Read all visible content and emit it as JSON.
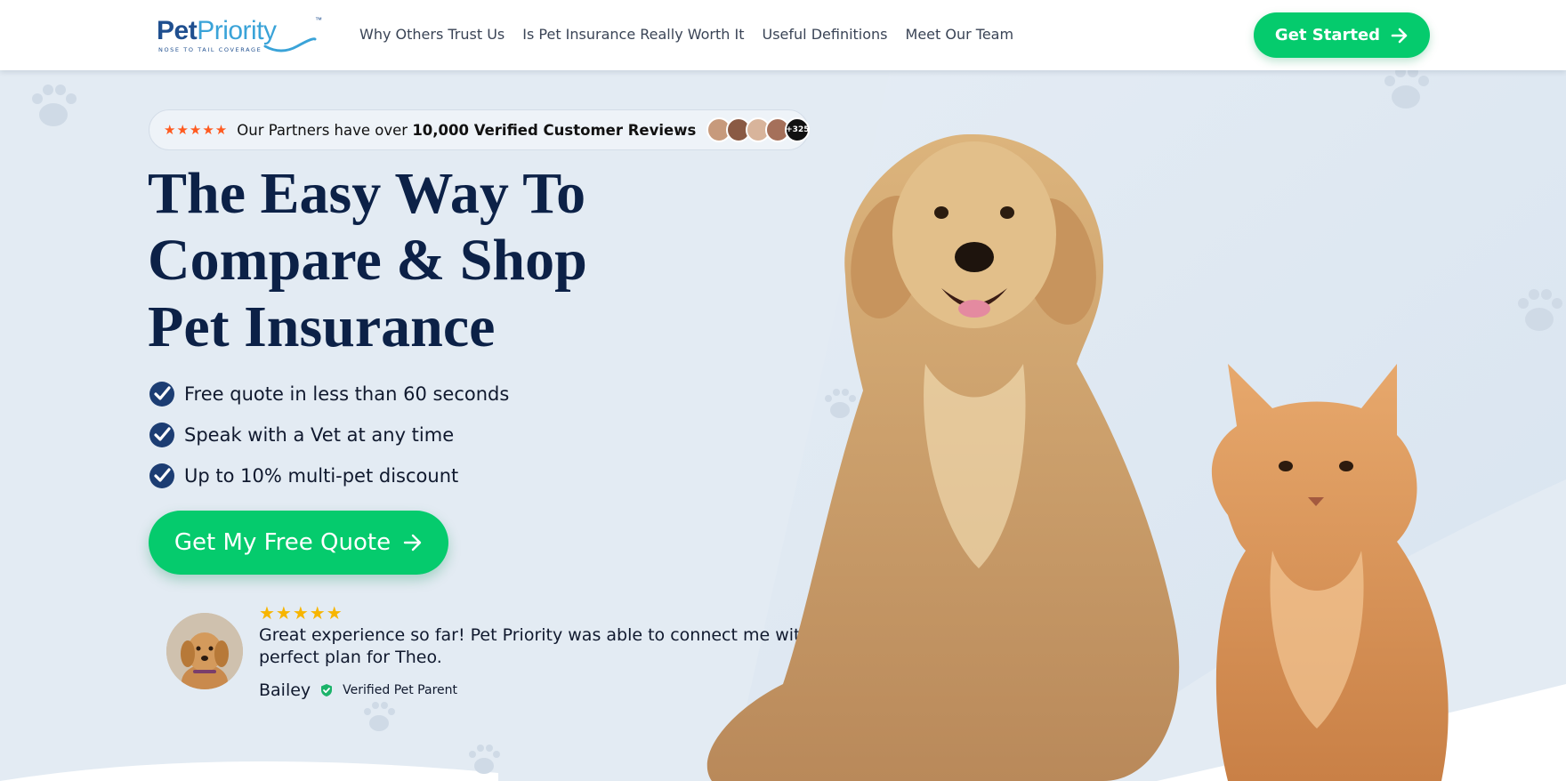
{
  "brand": {
    "name_part1": "Pet",
    "name_part2": "Priority",
    "tagline": "NOSE TO TAIL COVERAGE",
    "trademark": "™"
  },
  "nav": {
    "links": [
      {
        "label": "Why Others Trust Us"
      },
      {
        "label": "Is Pet Insurance Really Worth It"
      },
      {
        "label": "Useful Definitions"
      },
      {
        "label": "Meet Our Team"
      }
    ],
    "cta_label": "Get Started"
  },
  "reviews_pill": {
    "stars": "★★★★★",
    "text_prefix": "Our Partners have over ",
    "text_bold": "10,000 Verified Customer Reviews",
    "extra_count": "+325"
  },
  "hero": {
    "headline_lines": [
      "The Easy Way To",
      "Compare & Shop",
      "Pet Insurance"
    ],
    "benefits": [
      {
        "text": "Free quote in less than 60 seconds"
      },
      {
        "text": "Speak with a Vet at any time"
      },
      {
        "text": "Up to 10% multi-pet discount"
      }
    ],
    "cta_label": "Get My Free Quote"
  },
  "testimonial": {
    "stars": "★★★★★",
    "quote": "Great experience so far! Pet Priority was able to connect me with the perfect plan for Theo.",
    "author": "Bailey",
    "badge": "Verified Pet Parent"
  },
  "colors": {
    "accent_green": "#05cb6d",
    "navy": "#0c2147",
    "background": "#e3ebf3",
    "star_orange": "#ff5a1f",
    "star_gold": "#f7b500"
  }
}
